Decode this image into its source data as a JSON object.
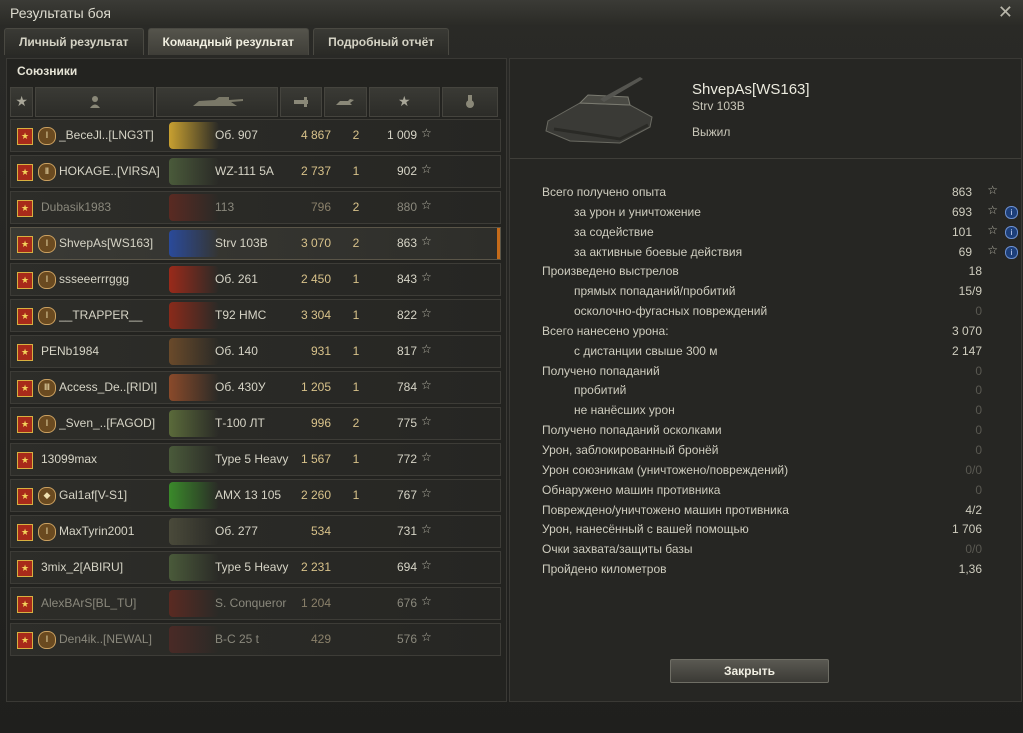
{
  "window": {
    "title": "Результаты боя"
  },
  "tabs": [
    {
      "label": "Личный результат",
      "active": false
    },
    {
      "label": "Командный результат",
      "active": true
    },
    {
      "label": "Подробный отчёт",
      "active": false
    }
  ],
  "allies": {
    "title": "Союзники",
    "header_icons": [
      "badge-icon",
      "player-icon",
      "tank-icon",
      "damage-icon",
      "kills-icon",
      "xp-star-icon",
      "medal-icon"
    ],
    "rows": [
      {
        "name": "_BeceJl..[LNG3T]",
        "tank": "Об. 907",
        "damage": "4 867",
        "kills": "2",
        "xp": "1 009",
        "alive": true,
        "clan": "Ⅰ",
        "color": "#c8a030"
      },
      {
        "name": "HOKAGE..[VIRSA]",
        "tank": "WZ-111 5A",
        "damage": "2 737",
        "kills": "1",
        "xp": "902",
        "alive": true,
        "clan": "Ⅱ",
        "color": "#4a5a3a"
      },
      {
        "name": "Dubasik1983",
        "tank": "113",
        "damage": "796",
        "kills": "2",
        "xp": "880",
        "alive": false,
        "clan": "",
        "color": "#5a2a22"
      },
      {
        "name": "ShvepAs[WS163]",
        "tank": "Strv 103B",
        "damage": "3 070",
        "kills": "2",
        "xp": "863",
        "alive": true,
        "clan": "Ⅰ",
        "color": "#2a4a9a"
      },
      {
        "name": "ssseeerrrggg",
        "tank": "Об. 261",
        "damage": "2 450",
        "kills": "1",
        "xp": "843",
        "alive": true,
        "clan": "Ⅰ",
        "color": "#9a2a1a"
      },
      {
        "name": "__TRAPPER__",
        "tank": "T92 HMC",
        "damage": "3 304",
        "kills": "1",
        "xp": "822",
        "alive": true,
        "clan": "Ⅰ",
        "color": "#8a2a1a"
      },
      {
        "name": "PENb1984",
        "tank": "Об. 140",
        "damage": "931",
        "kills": "1",
        "xp": "817",
        "alive": true,
        "clan": "",
        "color": "#6a4a2a"
      },
      {
        "name": "Access_De..[RIDI]",
        "tank": "Об. 430У",
        "damage": "1 205",
        "kills": "1",
        "xp": "784",
        "alive": true,
        "clan": "Ⅲ",
        "color": "#8a4a2a"
      },
      {
        "name": "_Sven_..[FAGOD]",
        "tank": "Т-100 ЛТ",
        "damage": "996",
        "kills": "2",
        "xp": "775",
        "alive": true,
        "clan": "Ⅰ",
        "color": "#5a6a3a"
      },
      {
        "name": "13099max",
        "tank": "Type 5 Heavy",
        "damage": "1 567",
        "kills": "1",
        "xp": "772",
        "alive": true,
        "clan": "",
        "color": "#4a5a3a"
      },
      {
        "name": "Gal1af[V-S1]",
        "tank": "AMX 13 105",
        "damage": "2 260",
        "kills": "1",
        "xp": "767",
        "alive": true,
        "clan": "◆",
        "color": "#3a8a2a"
      },
      {
        "name": "MaxTyrin2001",
        "tank": "Об. 277",
        "damage": "534",
        "kills": "",
        "xp": "731",
        "alive": true,
        "clan": "Ⅰ",
        "color": "#4a4a3a"
      },
      {
        "name": "3mix_2[ABIRU]",
        "tank": "Type 5 Heavy",
        "damage": "2 231",
        "kills": "",
        "xp": "694",
        "alive": true,
        "clan": "",
        "color": "#4a5a3a"
      },
      {
        "name": "AlexBArS[BL_TU]",
        "tank": "S. Conqueror",
        "damage": "1 204",
        "kills": "",
        "xp": "676",
        "alive": false,
        "clan": "",
        "color": "#5a2a22"
      },
      {
        "name": "Den4ik..[NEWAL]",
        "tank": "B-C 25 t",
        "damage": "429",
        "kills": "",
        "xp": "576",
        "alive": false,
        "clan": "Ⅰ",
        "color": "#4a2a26"
      }
    ]
  },
  "vehicle": {
    "player": "ShvepAs[WS163]",
    "tank": "Strv 103B",
    "status": "Выжил"
  },
  "stats": [
    {
      "label": "Всего получено опыта",
      "value": "863",
      "sub": false,
      "star": true,
      "info": false,
      "zero": false
    },
    {
      "label": "за урон и уничтожение",
      "value": "693",
      "sub": true,
      "star": true,
      "info": true,
      "zero": false
    },
    {
      "label": "за содействие",
      "value": "101",
      "sub": true,
      "star": true,
      "info": true,
      "zero": false
    },
    {
      "label": "за активные боевые действия",
      "value": "69",
      "sub": true,
      "star": true,
      "info": true,
      "zero": false
    },
    {
      "label": "Произведено выстрелов",
      "value": "18",
      "sub": false,
      "star": false,
      "info": false,
      "zero": false
    },
    {
      "label": "прямых попаданий/пробитий",
      "value": "15/9",
      "sub": true,
      "star": false,
      "info": false,
      "zero": false
    },
    {
      "label": "осколочно-фугасных повреждений",
      "value": "0",
      "sub": true,
      "star": false,
      "info": false,
      "zero": true
    },
    {
      "label": "Всего нанесено урона:",
      "value": "3 070",
      "sub": false,
      "star": false,
      "info": false,
      "zero": false
    },
    {
      "label": "с дистанции свыше 300 м",
      "value": "2 147",
      "sub": true,
      "star": false,
      "info": false,
      "zero": false
    },
    {
      "label": "Получено попаданий",
      "value": "0",
      "sub": false,
      "star": false,
      "info": false,
      "zero": true
    },
    {
      "label": "пробитий",
      "value": "0",
      "sub": true,
      "star": false,
      "info": false,
      "zero": true
    },
    {
      "label": "не нанёсших урон",
      "value": "0",
      "sub": true,
      "star": false,
      "info": false,
      "zero": true
    },
    {
      "label": "Получено попаданий осколками",
      "value": "0",
      "sub": false,
      "star": false,
      "info": false,
      "zero": true
    },
    {
      "label": "Урон, заблокированный бронёй",
      "value": "0",
      "sub": false,
      "star": false,
      "info": false,
      "zero": true
    },
    {
      "label": "Урон союзникам (уничтожено/повреждений)",
      "value": "0/0",
      "sub": false,
      "star": false,
      "info": false,
      "zero": true
    },
    {
      "label": "Обнаружено машин противника",
      "value": "0",
      "sub": false,
      "star": false,
      "info": false,
      "zero": true
    },
    {
      "label": "Повреждено/уничтожено машин противника",
      "value": "4/2",
      "sub": false,
      "star": false,
      "info": false,
      "zero": false
    },
    {
      "label": "Урон, нанесённый с вашей помощью",
      "value": "1 706",
      "sub": false,
      "star": false,
      "info": false,
      "zero": false
    },
    {
      "label": "Очки захвата/защиты базы",
      "value": "0/0",
      "sub": false,
      "star": false,
      "info": false,
      "zero": true
    },
    {
      "label": "Пройдено километров",
      "value": "1,36",
      "sub": false,
      "star": false,
      "info": false,
      "zero": false
    }
  ],
  "buttons": {
    "close": "Закрыть"
  }
}
